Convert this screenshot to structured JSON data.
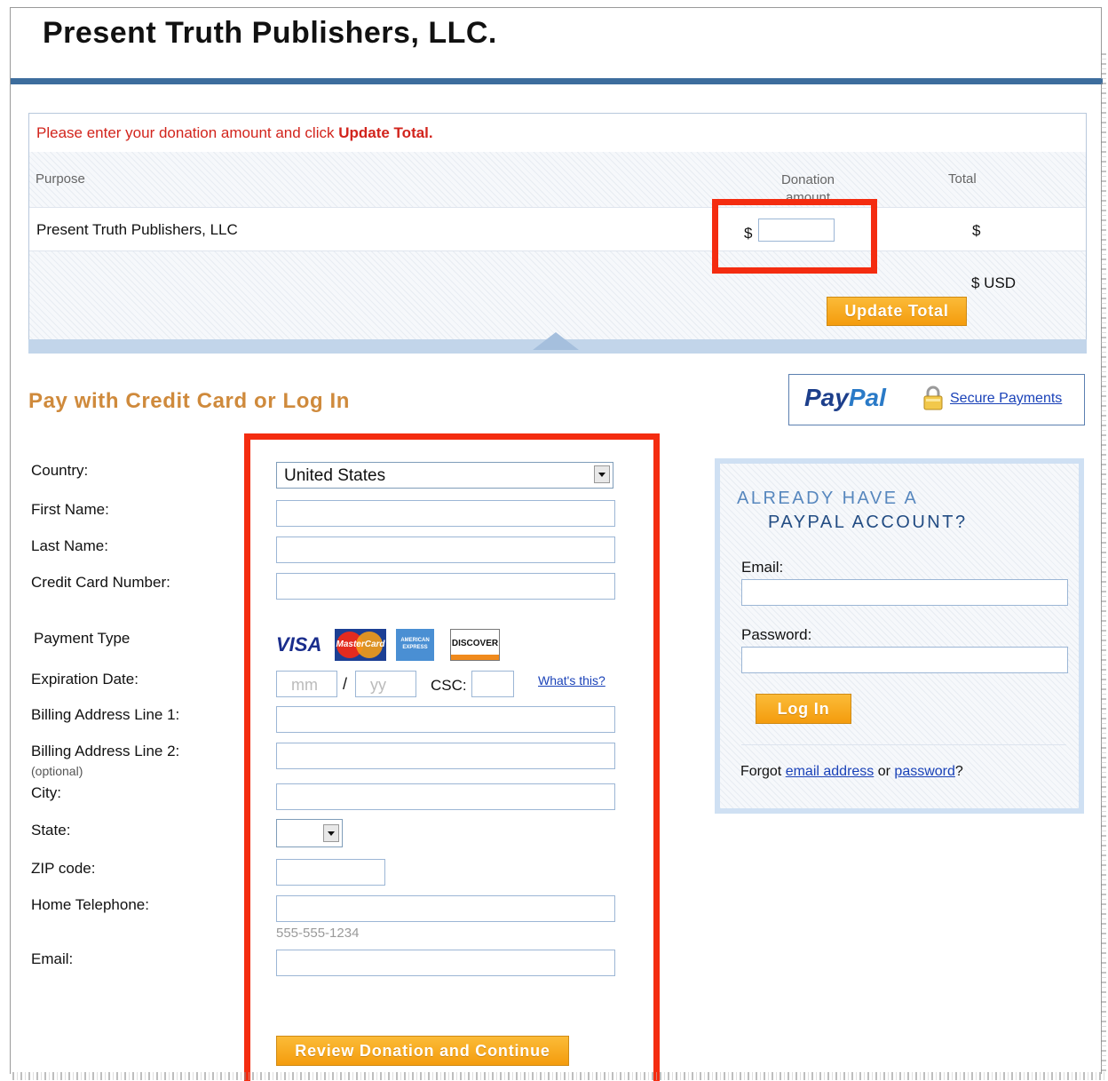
{
  "header": {
    "title": "Present Truth Publishers, LLC."
  },
  "cart": {
    "notice_text": "Please enter your donation amount and click ",
    "notice_bold": "Update Total.",
    "columns": {
      "purpose": "Purpose",
      "donation": "Donation amount",
      "total": "Total"
    },
    "row": {
      "purpose": "Present Truth Publishers, LLC",
      "currency_symbol": "$",
      "total_symbol": "$"
    },
    "total_line": "$ USD",
    "update_button": "Update Total"
  },
  "payment": {
    "title": "Pay with Credit Card or Log In",
    "paypal_logo_a": "Pay",
    "paypal_logo_b": "Pal",
    "secure_link": "Secure Payments",
    "fields": {
      "country": "Country:",
      "country_value": "United States",
      "first_name": "First Name:",
      "last_name": "Last Name:",
      "card_number": "Credit Card Number:",
      "payment_type": "Payment Type",
      "expiration": "Expiration Date:",
      "exp_month_placeholder": "mm",
      "exp_sep": "/",
      "exp_year_placeholder": "yy",
      "csc": "CSC:",
      "whats_this": "What's this?",
      "billing1": "Billing Address Line 1:",
      "billing2": "Billing Address Line 2:",
      "optional": "(optional)",
      "city": "City:",
      "state": "State:",
      "zip": "ZIP code:",
      "phone": "Home Telephone:",
      "phone_hint": "555-555-1234",
      "email": "Email:"
    },
    "cards": {
      "visa": "VISA",
      "mastercard": "MasterCard",
      "amex": "AMERICAN EXPRESS",
      "discover": "DISCOVER"
    },
    "review_button": "Review Donation and Continue"
  },
  "login": {
    "heading_line1": "ALREADY HAVE A",
    "heading_line2": "PAYPAL ACCOUNT?",
    "email_label": "Email:",
    "password_label": "Password:",
    "login_button": "Log In",
    "forgot_prefix": "Forgot ",
    "forgot_email": "email address",
    "forgot_or": " or ",
    "forgot_password": "password",
    "forgot_suffix": "?"
  },
  "colors": {
    "accent_red": "#f42c10",
    "header_rule": "#3d6d9d",
    "button_orange": "#f49c0d",
    "section_title": "#cf8a3c",
    "link_blue": "#1a42b8"
  }
}
